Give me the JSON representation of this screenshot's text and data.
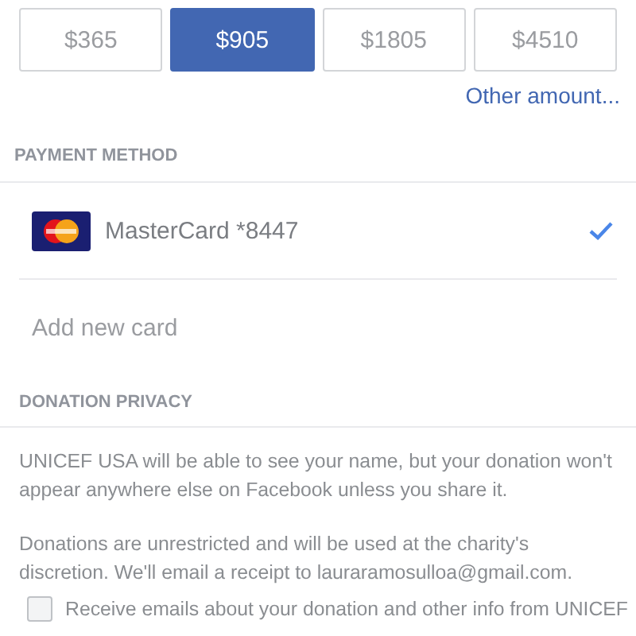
{
  "amounts": [
    {
      "label": "$365",
      "selected": false
    },
    {
      "label": "$905",
      "selected": true
    },
    {
      "label": "$1805",
      "selected": false
    },
    {
      "label": "$4510",
      "selected": false
    }
  ],
  "other_amount": "Other amount...",
  "payment_method": {
    "heading": "PAYMENT METHOD",
    "cards": [
      {
        "label": "MasterCard *8447",
        "selected": true
      }
    ],
    "add_card": "Add new card"
  },
  "donation_privacy": {
    "heading": "DONATION PRIVACY",
    "paragraphs": [
      "UNICEF USA will be able to see your name, but your donation won't appear anywhere else on Facebook unless you share it.",
      "Donations are unrestricted and will be used at the charity's discretion. We'll email a receipt to lauraramosulloa@gmail.com."
    ],
    "email_optin": {
      "label": "Receive emails about your donation and other info from UNICEF",
      "checked": false
    }
  }
}
